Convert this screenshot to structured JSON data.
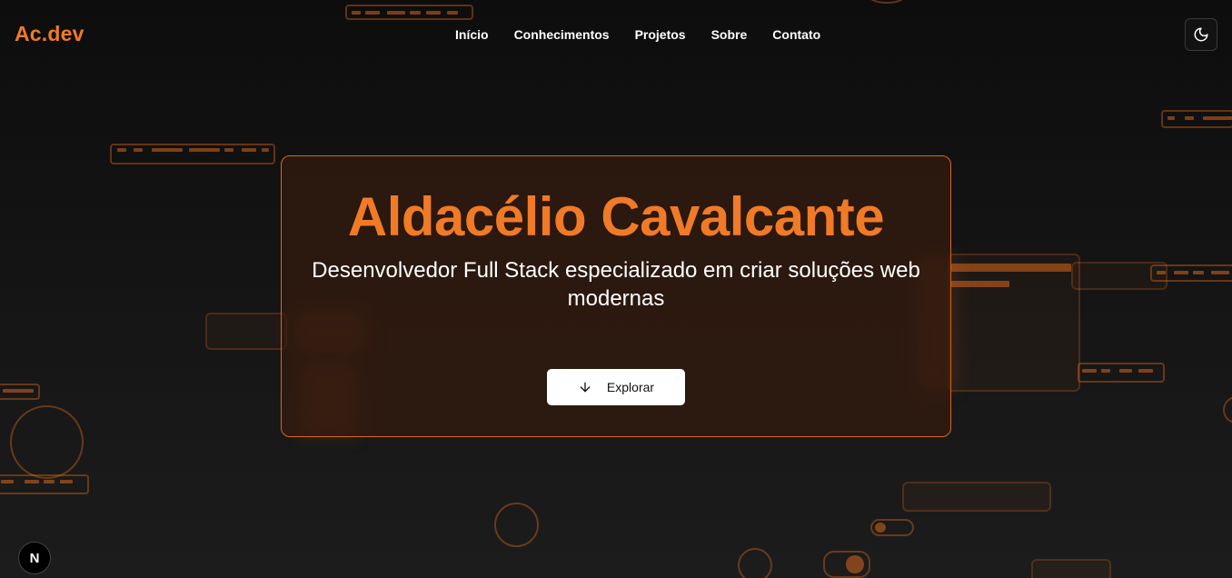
{
  "header": {
    "logo": "Ac.dev",
    "nav": [
      "Início",
      "Conhecimentos",
      "Projetos",
      "Sobre",
      "Contato"
    ],
    "theme_icon": "moon-icon"
  },
  "hero": {
    "name": "Aldacélio Cavalcante",
    "subtitle": "Desenvolvedor Full Stack especializado em criar soluções web modernas",
    "button_label": "Explorar",
    "button_icon": "arrow-down-icon"
  },
  "badge": {
    "label": "N",
    "icon": "nextjs-icon"
  },
  "colors": {
    "accent": "#f07a26",
    "background": "#121212",
    "card": "#341a0e"
  }
}
